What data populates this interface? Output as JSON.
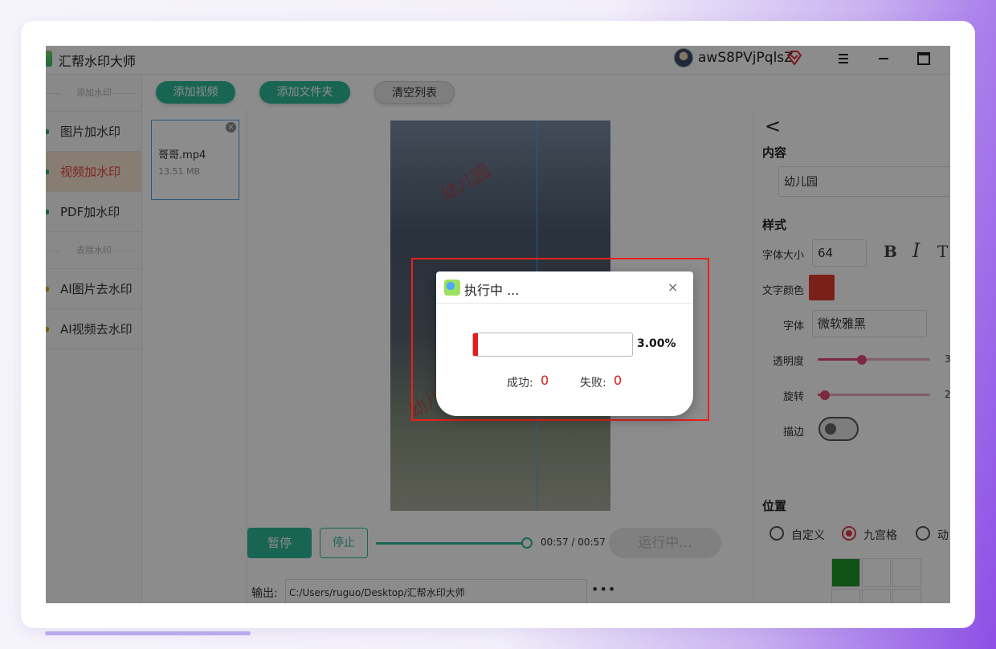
{
  "app": {
    "title": "汇帮水印大师"
  },
  "user": {
    "name": "awS8PVjPqlsZ"
  },
  "sidebar": {
    "section_add": "添加水印",
    "section_remove": "去除水印",
    "items": [
      {
        "label": "图片加水印",
        "mark_color": "#3cb371"
      },
      {
        "label": "视频加水印",
        "mark_color": "#3cb371"
      },
      {
        "label": "PDF加水印",
        "mark_color": "#3cb371"
      },
      {
        "label": "AI图片去水印",
        "mark_color": "#f0a030"
      },
      {
        "label": "AI视频去水印",
        "mark_color": "#f0a030"
      }
    ]
  },
  "toolbar": {
    "add_video": "添加视频",
    "add_folder": "添加文件夹",
    "clear_list": "清空列表"
  },
  "files": [
    {
      "name": "哥哥.mp4",
      "size": "13.51 MB"
    }
  ],
  "preview": {
    "watermark_text": "幼儿园"
  },
  "controls": {
    "pause": "暂停",
    "stop": "停止",
    "time": "00:57 / 00:57",
    "run": "运行中...",
    "playback_position": 1.0
  },
  "output": {
    "label": "输出:",
    "path": "C:/Users/ruguo/Desktop/汇帮水印大师",
    "more": "•••"
  },
  "panel": {
    "back": "<",
    "content_heading": "内容",
    "content_value": "幼儿园",
    "style_heading": "样式",
    "font_size_label": "字体大小",
    "font_size_value": "64",
    "bold": "B",
    "italic": "I",
    "text_tool": "T",
    "text_color_label": "文字颜色",
    "text_color": "#e03b2f",
    "font_label": "字体",
    "font_value": "微软雅黑",
    "opacity_label": "透明度",
    "opacity_value": "3",
    "rotate_label": "旋转",
    "rotate_value": "2",
    "stroke_label": "描边",
    "stroke_enabled": false,
    "position_heading": "位置",
    "pos_custom": "自定义",
    "pos_grid": "九宫格",
    "pos_dynamic": "动",
    "grid_selected_color": "#21962a"
  },
  "dialog": {
    "title": "执行中 ...",
    "close": "×",
    "progress_percent": 3.0,
    "progress_text": "3.00%",
    "success_label": "成功:",
    "success_value": "0",
    "fail_label": "失败:",
    "fail_value": "0"
  }
}
